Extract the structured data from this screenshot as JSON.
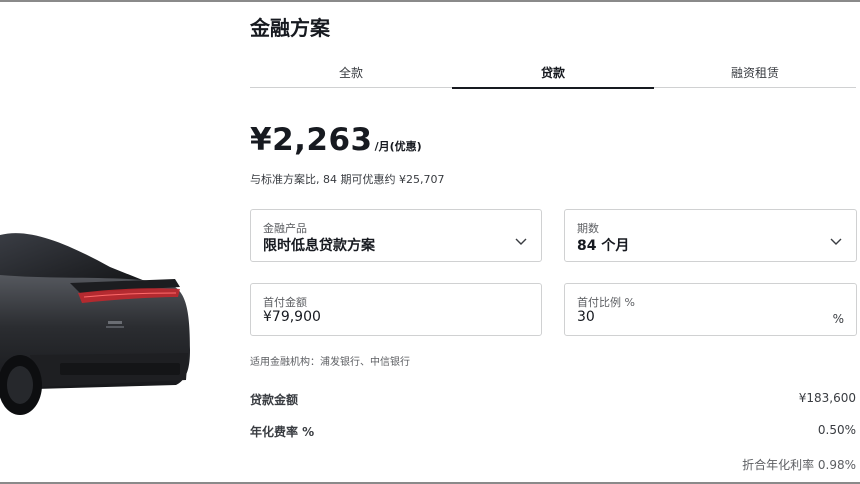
{
  "page_title": "金融方案",
  "tabs": [
    {
      "label": "全款",
      "active": false
    },
    {
      "label": "贷款",
      "active": true
    },
    {
      "label": "融资租赁",
      "active": false
    }
  ],
  "price": {
    "amount": "¥2,263",
    "unit": "/月(优惠)",
    "savings_note": "与标准方案比, 84 期可优惠约 ¥25,707"
  },
  "fields": {
    "product": {
      "label": "金融产品",
      "value": "限时低息贷款方案"
    },
    "term": {
      "label": "期数",
      "value": "84 个月"
    },
    "down_payment": {
      "label": "首付金额",
      "value": "¥79,900"
    },
    "down_ratio": {
      "label": "首付比例 %",
      "value": "30",
      "suffix": "%"
    }
  },
  "institutions": "适用金融机构：浦发银行、中信银行",
  "summary": [
    {
      "label": "贷款金额",
      "value": "¥183,600"
    },
    {
      "label": "年化费率 %",
      "value": "0.50%"
    }
  ],
  "apr_note": "折合年化利率 0.98%",
  "colors": {
    "text": "#171a20",
    "border": "#d0d1d2",
    "car_body": "#2b2d31",
    "tail_light": "#c8262b"
  }
}
